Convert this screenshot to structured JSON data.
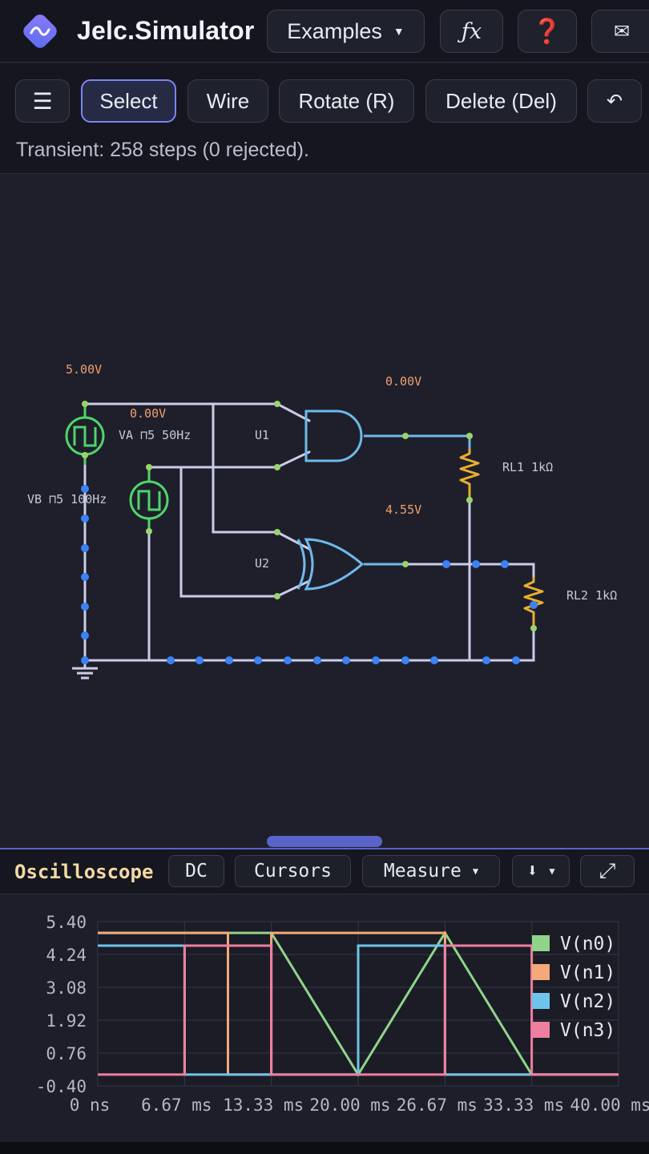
{
  "app": {
    "title": "Jelc.Simulator"
  },
  "topbar": {
    "examples_label": "Examples",
    "formula_label": "ƒx",
    "help_label": "❓",
    "mail_label": "✉"
  },
  "toolbar": {
    "menu_label": "☰",
    "select_label": "Select",
    "wire_label": "Wire",
    "rotate_label": "Rotate (R)",
    "delete_label": "Delete (Del)",
    "undo_label": "↶",
    "status": "Transient: 258 steps (0 rejected)."
  },
  "circuit": {
    "labels": {
      "v_top": "5.00V",
      "v_and_out": "0.00V",
      "v_mid": "0.00V",
      "va": "VA ⊓5 50Hz",
      "vb": "VB ⊓5 100Hz",
      "u1": "U1",
      "u2": "U2",
      "v_xor_out": "4.55V",
      "rl1": "RL1 1kΩ",
      "rl2": "RL2 1kΩ"
    }
  },
  "scope": {
    "title": "Oscilloscope",
    "dc_label": "DC",
    "cursors_label": "Cursors",
    "measure_label": "Measure",
    "export_label": "⬇",
    "expand_label": "⤢"
  },
  "colors": {
    "n0": "#8fd48a",
    "n1": "#f4a97a",
    "n2": "#6fc3ea",
    "n3": "#ee7fa0",
    "wire": "#c9cde8",
    "active_wire": "#6fb9ea",
    "source": "#4fd46b",
    "resistor": "#e8b030",
    "node_dot": "#3b82f6",
    "pin_dot": "#9bd46b",
    "voltage_label": "#f0a070"
  },
  "chart_data": {
    "type": "line",
    "title": "",
    "xlabel": "",
    "ylabel": "",
    "x_ticks": [
      "0 ns",
      "6.67 ms",
      "13.33 ms",
      "20.00 ms",
      "26.67 ms",
      "33.33 ms",
      "40.00 ms"
    ],
    "y_ticks": [
      "5.40",
      "4.24",
      "3.08",
      "1.92",
      "0.76",
      "-0.40"
    ],
    "xlim": [
      0,
      40
    ],
    "ylim": [
      -0.4,
      5.4
    ],
    "x_unit": "ms",
    "legend_position": "top-right",
    "series": [
      {
        "name": "V(n0)",
        "color_key": "n0",
        "x": [
          0,
          6.67,
          6.67,
          10,
          10,
          13.33,
          13.33,
          20,
          20,
          26.67,
          26.67,
          33.33,
          33.33,
          40
        ],
        "values": [
          5.0,
          5.0,
          5.0,
          5.0,
          5.0,
          5.0,
          5.0,
          0,
          0,
          5.0,
          5.0,
          0,
          0,
          0
        ]
      },
      {
        "name": "V(n1)",
        "color_key": "n1",
        "x": [
          0,
          6.67,
          6.67,
          10,
          10,
          13.33,
          13.33,
          20,
          20,
          26.67,
          26.67,
          33.33,
          33.33,
          40
        ],
        "values": [
          5.0,
          5.0,
          5.0,
          5.0,
          0,
          0,
          5.0,
          5.0,
          5.0,
          5.0,
          0,
          0,
          0,
          0
        ]
      },
      {
        "name": "V(n2)",
        "color_key": "n2",
        "x": [
          0,
          6.67,
          6.67,
          10,
          10,
          13.33,
          13.33,
          20,
          20,
          26.67,
          26.67,
          33.33,
          33.33,
          40
        ],
        "values": [
          4.55,
          4.55,
          0,
          0,
          0,
          0,
          0,
          0,
          4.55,
          4.55,
          0,
          0,
          0,
          0
        ]
      },
      {
        "name": "V(n3)",
        "color_key": "n3",
        "x": [
          0,
          6.67,
          6.67,
          10,
          10,
          13.33,
          13.33,
          20,
          20,
          26.67,
          26.67,
          33.33,
          33.33,
          40
        ],
        "values": [
          0,
          0,
          4.55,
          4.55,
          4.55,
          4.55,
          0,
          0,
          0,
          0,
          4.55,
          4.55,
          0,
          0
        ]
      }
    ]
  }
}
